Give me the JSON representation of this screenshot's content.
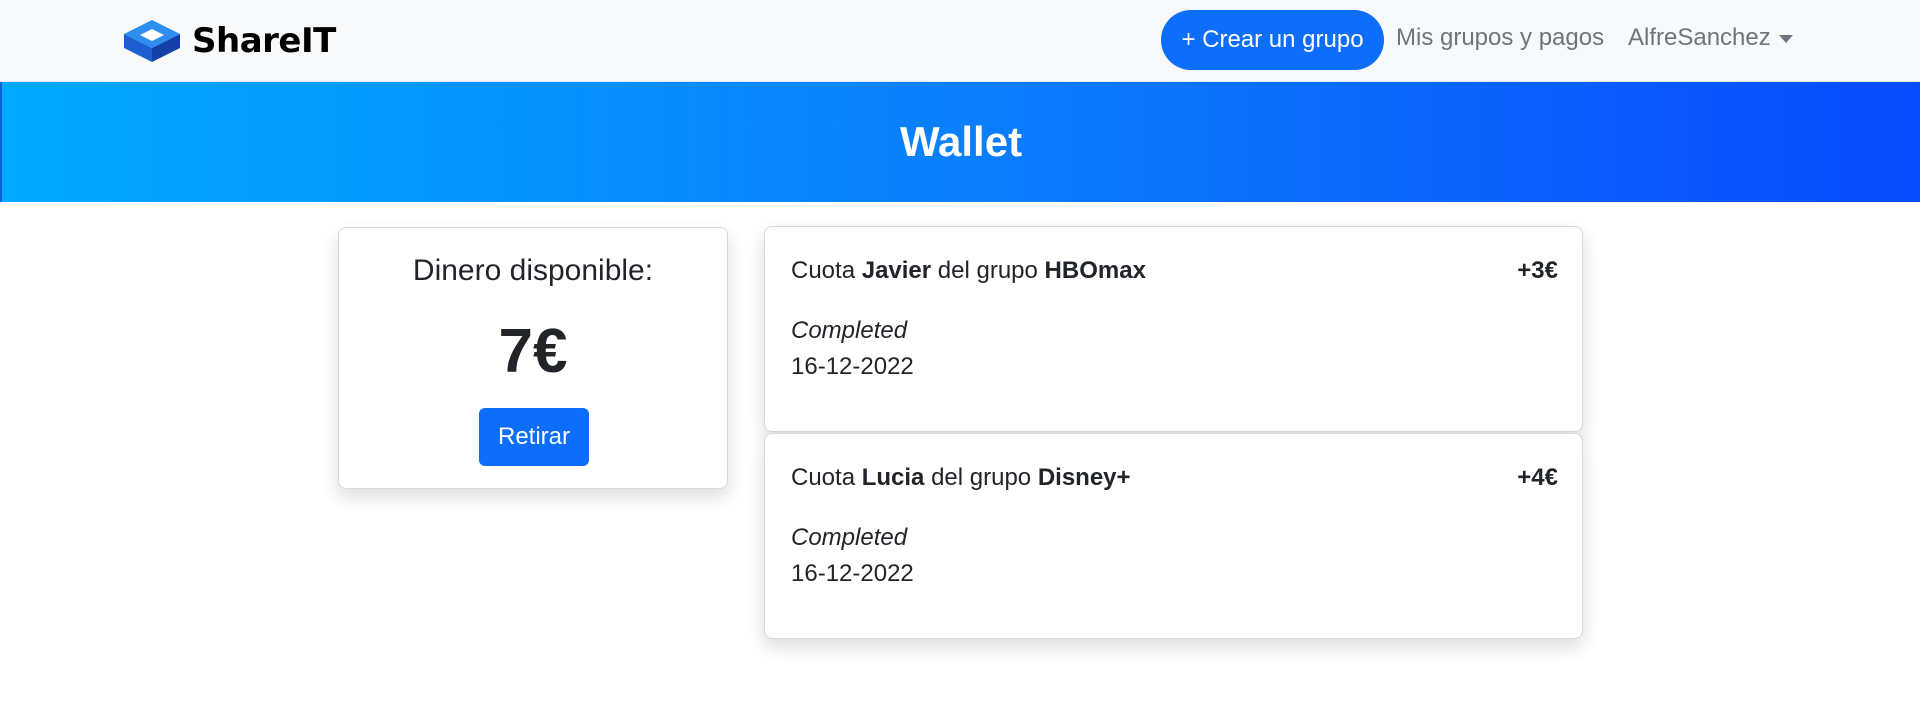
{
  "nav": {
    "brand": "ShareIT",
    "create_group": "+ Crear un grupo",
    "my_groups": "Mis grupos y pagos",
    "user": "AlfreSanchez"
  },
  "page": {
    "title": "Wallet"
  },
  "balance": {
    "label": "Dinero disponible:",
    "amount": "7€",
    "withdraw": "Retirar"
  },
  "transactions": [
    {
      "prefix": "Cuota",
      "user": "Javier",
      "middle": "del grupo",
      "group": "HBOmax",
      "amount": "+3€",
      "status": "Completed",
      "date": "16-12-2022"
    },
    {
      "prefix": "Cuota",
      "user": "Lucia",
      "middle": "del grupo",
      "group": "Disney+",
      "amount": "+4€",
      "status": "Completed",
      "date": "16-12-2022"
    }
  ],
  "colors": {
    "primary": "#0d6efd",
    "banner_start": "#00aaff",
    "banner_end": "#0a4bff"
  },
  "icons": {
    "brand_logo": "cube-logo-icon",
    "user_menu": "caret-down-icon"
  }
}
